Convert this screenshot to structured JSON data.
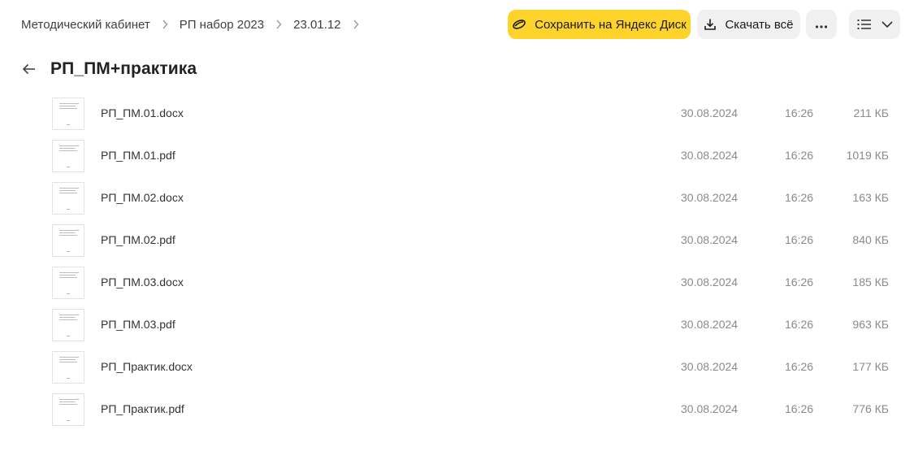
{
  "breadcrumbs": [
    "Методический кабинет",
    "РП набор 2023",
    "23.01.12"
  ],
  "toolbar": {
    "save_label": "Сохранить на Яндекс Диск",
    "download_label": "Скачать всё"
  },
  "folder": {
    "title": "РП_ПМ+практика"
  },
  "files": [
    {
      "name": "РП_ПМ.01.docx",
      "date": "30.08.2024",
      "time": "16:26",
      "size": "211 КБ"
    },
    {
      "name": "РП_ПМ.01.pdf",
      "date": "30.08.2024",
      "time": "16:26",
      "size": "1019 КБ"
    },
    {
      "name": "РП_ПМ.02.docx",
      "date": "30.08.2024",
      "time": "16:26",
      "size": "163 КБ"
    },
    {
      "name": "РП_ПМ.02.pdf",
      "date": "30.08.2024",
      "time": "16:26",
      "size": "840 КБ"
    },
    {
      "name": "РП_ПМ.03.docx",
      "date": "30.08.2024",
      "time": "16:26",
      "size": "185 КБ"
    },
    {
      "name": "РП_ПМ.03.pdf",
      "date": "30.08.2024",
      "time": "16:26",
      "size": "963 КБ"
    },
    {
      "name": "РП_Практик.docx",
      "date": "30.08.2024",
      "time": "16:26",
      "size": "177 КБ"
    },
    {
      "name": "РП_Практик.pdf",
      "date": "30.08.2024",
      "time": "16:26",
      "size": "776 КБ"
    }
  ],
  "colors": {
    "accent": "#fed42b",
    "button_bg": "#f0f0f1",
    "muted_text": "#8a8a8a"
  },
  "icons": [
    "chevron-right-icon",
    "disk-save-icon",
    "download-icon",
    "more-icon",
    "list-view-icon",
    "chevron-down-icon",
    "arrow-left-icon"
  ]
}
